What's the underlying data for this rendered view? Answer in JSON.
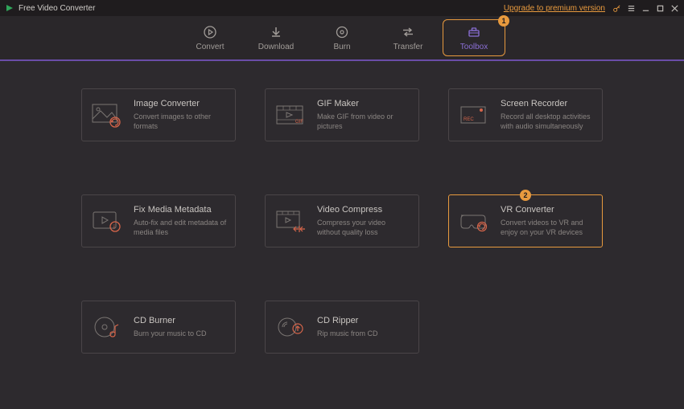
{
  "titlebar": {
    "app_name": "Free Video Converter",
    "upgrade_text": "Upgrade to premium version"
  },
  "nav": {
    "items": [
      {
        "label": "Convert"
      },
      {
        "label": "Download"
      },
      {
        "label": "Burn"
      },
      {
        "label": "Transfer"
      },
      {
        "label": "Toolbox"
      }
    ],
    "active_badge": "1"
  },
  "tools": {
    "image_converter": {
      "title": "Image Converter",
      "desc": "Convert images to other formats"
    },
    "gif_maker": {
      "title": "GIF Maker",
      "desc": "Make GIF from video or pictures"
    },
    "screen_recorder": {
      "title": "Screen Recorder",
      "desc": "Record all desktop activities with audio simultaneously"
    },
    "fix_metadata": {
      "title": "Fix Media Metadata",
      "desc": "Auto-fix and edit metadata of media files"
    },
    "video_compress": {
      "title": "Video Compress",
      "desc": "Compress your video without quality loss"
    },
    "vr_converter": {
      "title": "VR Converter",
      "desc": "Convert videos to VR and enjoy on your VR devices",
      "badge": "2"
    },
    "cd_burner": {
      "title": "CD Burner",
      "desc": "Burn your music to CD"
    },
    "cd_ripper": {
      "title": "CD Ripper",
      "desc": "Rip music from CD"
    }
  },
  "colors": {
    "accent_orange": "#e89a3e",
    "accent_purple": "#6a4da8"
  }
}
